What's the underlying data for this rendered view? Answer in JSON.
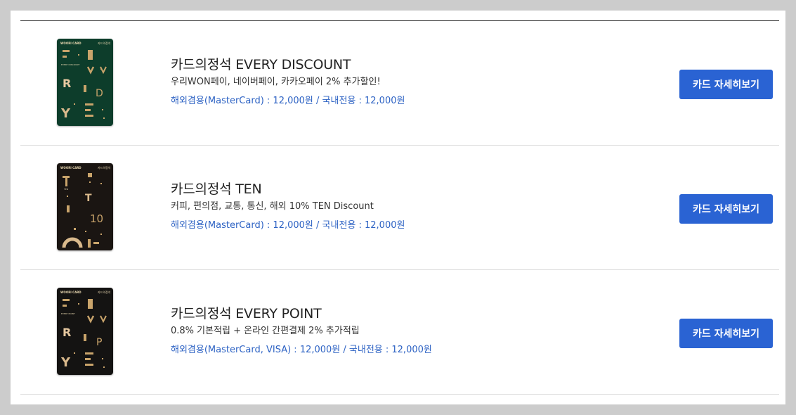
{
  "cards": [
    {
      "title": "카드의정석 EVERY DISCOUNT",
      "description": "우리WON페이, 네이버페이, 카카오페이 2% 추가할인!",
      "fee": "해외겸용(MasterCard) : 12,000원 / 국내전용 : 12,000원",
      "button_label": "카드 자세히보기",
      "card_color": "#0d3d2b",
      "card_brand_text": "WOORI CARD",
      "card_issuer_text": "카드의정석",
      "card_name_text": "EVERY DISCOUNT",
      "card_letters": [
        "R",
        "Y",
        "D"
      ]
    },
    {
      "title": "카드의정석 TEN",
      "description": "커피, 편의점, 교통, 통신, 해외 10% TEN Discount",
      "fee": "해외겸용(MasterCard) : 12,000원 / 국내전용 : 12,000원",
      "button_label": "카드 자세히보기",
      "card_color": "#1a1512",
      "card_brand_text": "WOORI CARD",
      "card_issuer_text": "카드의정석",
      "card_name_text": "TEN",
      "card_letters": [
        "T",
        "10"
      ]
    },
    {
      "title": "카드의정석 EVERY POINT",
      "description": "0.8% 기본적립 + 온라인 간편결제 2% 추가적립",
      "fee": "해외겸용(MasterCard, VISA) : 12,000원 / 국내전용 : 12,000원",
      "button_label": "카드 자세히보기",
      "card_color": "#141312",
      "card_brand_text": "WOORI CARD",
      "card_issuer_text": "카드의정석",
      "card_name_text": "EVERY POINT",
      "card_letters": [
        "R",
        "Y",
        "P"
      ]
    }
  ],
  "colors": {
    "accent": "#2a63d3",
    "fee_text": "#2e63c4",
    "gold": "#c9a46b"
  }
}
